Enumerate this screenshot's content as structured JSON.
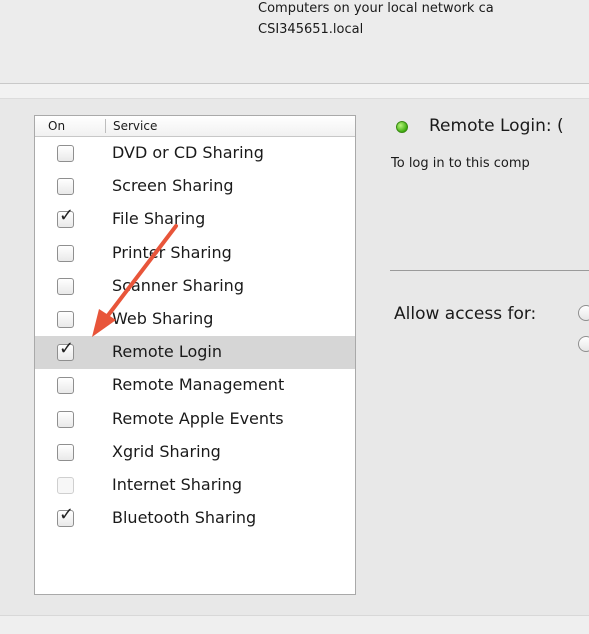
{
  "description": {
    "line1": "Computers on your local network ca",
    "line2": "CSI345651.local"
  },
  "service_list": {
    "header_on": "On",
    "header_service": "Service",
    "items": [
      {
        "label": "DVD or CD Sharing",
        "checked": false
      },
      {
        "label": "Screen Sharing",
        "checked": false
      },
      {
        "label": "File Sharing",
        "checked": true
      },
      {
        "label": "Printer Sharing",
        "checked": false
      },
      {
        "label": "Scanner Sharing",
        "checked": false
      },
      {
        "label": "Web Sharing",
        "checked": false
      },
      {
        "label": "Remote Login",
        "checked": true,
        "selected": true
      },
      {
        "label": "Remote Management",
        "checked": false
      },
      {
        "label": "Remote Apple Events",
        "checked": false
      },
      {
        "label": "Xgrid Sharing",
        "checked": false
      },
      {
        "label": "Internet Sharing",
        "checked": false,
        "disabled": true
      },
      {
        "label": "Bluetooth Sharing",
        "checked": true
      }
    ]
  },
  "status": {
    "text": "Remote Login: (",
    "indicator_color": "#3fae10"
  },
  "login_info": "To log in to this comp",
  "access": {
    "label": "Allow access for:"
  },
  "annotation": {
    "arrow_color": "#e8553a"
  }
}
